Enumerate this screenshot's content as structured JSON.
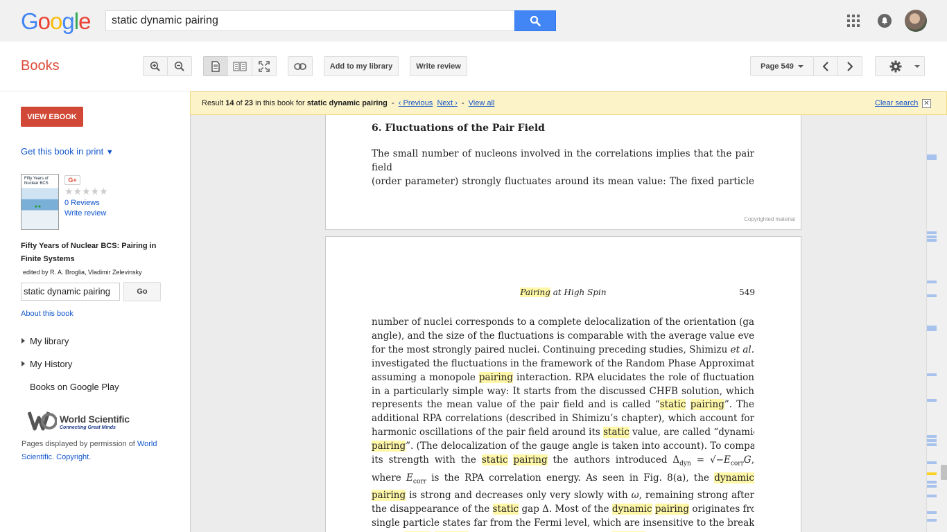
{
  "header": {
    "logo": [
      "G",
      "o",
      "o",
      "g",
      "l",
      "e"
    ],
    "search_value": "static dynamic pairing"
  },
  "toolbar": {
    "section_title": "Books",
    "add_library": "Add to my library",
    "write_review": "Write review",
    "page_label": "Page 549"
  },
  "sidebar": {
    "view_ebook": "VIEW EBOOK",
    "get_print": "Get this book in print",
    "cover_text": "Fifty Years of Nuclear BCS",
    "gplus": "G+",
    "stars": "★★★★★",
    "reviews": "0 Reviews",
    "write_review": "Write review",
    "book_title": "Fifty Years of Nuclear BCS: Pairing in Finite Systems",
    "editors": "edited by R. A. Broglia, Vladimir Zelevinsky",
    "search_value": "static dynamic pairing",
    "go": "Go",
    "about": "About this book",
    "my_library": "My library",
    "my_history": "My History",
    "books_play": "Books on Google Play",
    "publisher_name": "World Scientific",
    "publisher_tag": "Connecting Great Minds",
    "permission_prefix": "Pages displayed by permission of",
    "permission_link": "World Scientific",
    "copyright_link": "Copyright"
  },
  "result": {
    "prefix": "Result",
    "index": "14",
    "of": "of",
    "total": "23",
    "middle": "in this book for",
    "query": "static dynamic pairing",
    "previous": "‹ Previous",
    "next": "Next ›",
    "view_all": "View all",
    "clear": "Clear search",
    "close": "✕"
  },
  "page_top": {
    "section": "6.  Fluctuations of the Pair Field",
    "lines": [
      "The small number of nucleons involved in the correlations implies that the pair field",
      "(order parameter) strongly fluctuates around its mean value:  The fixed particle"
    ],
    "copyright": "Copyrighted material"
  },
  "page_main": {
    "running_head_hl": "Pairing",
    "running_head_rest": "at High Spin",
    "page_number": "549"
  },
  "colors": {
    "highlight": "#fff7a8",
    "accent_red": "#dd4b39",
    "link_blue": "#1155cc",
    "search_blue": "#4285f4"
  }
}
